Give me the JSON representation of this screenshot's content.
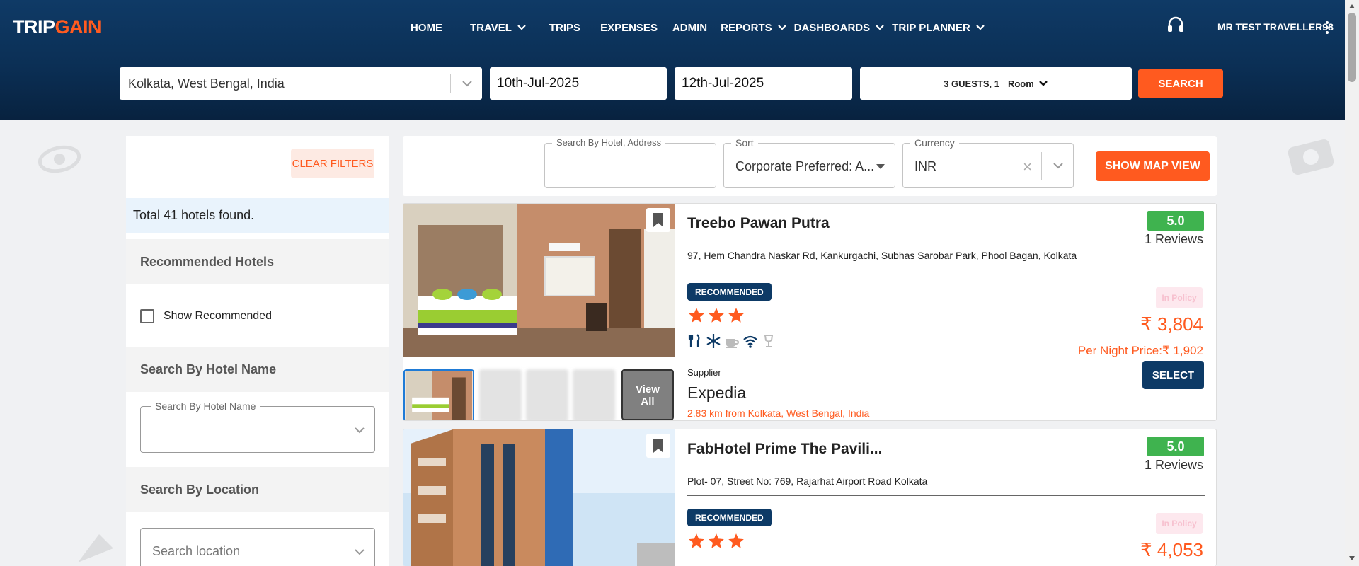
{
  "header": {
    "logo_left": "TRIP",
    "logo_right": "GAIN",
    "nav": [
      {
        "label": "HOME",
        "dropdown": false
      },
      {
        "label": "TRAVEL",
        "dropdown": true
      },
      {
        "label": "TRIPS",
        "dropdown": false
      },
      {
        "label": "EXPENSES",
        "dropdown": false
      },
      {
        "label": "ADMIN",
        "dropdown": false
      },
      {
        "label": "REPORTS",
        "dropdown": true
      },
      {
        "label": "DASHBOARDS",
        "dropdown": true
      },
      {
        "label": "TRIP PLANNER",
        "dropdown": true
      }
    ],
    "user": "MR TEST TRAVELLER98"
  },
  "search": {
    "location": "Kolkata, West Bengal, India",
    "checkin": "10th-Jul-2025",
    "checkout": "12th-Jul-2025",
    "guests": "3 GUESTS, 1",
    "room": "Room",
    "button": "SEARCH"
  },
  "sidebar": {
    "clear_filters": "CLEAR FILTERS",
    "total": "Total 41 hotels found.",
    "recommended_head": "Recommended Hotels",
    "show_recommended": "Show Recommended",
    "hotel_name_head": "Search By Hotel Name",
    "hotel_name_label": "Search By Hotel Name",
    "location_head": "Search By Location",
    "location_placeholder": "Search location"
  },
  "filters": {
    "search_label": "Search By Hotel, Address",
    "search_value": "",
    "sort_label": "Sort",
    "sort_value": "Corporate Preferred: A...",
    "currency_label": "Currency",
    "currency_value": "INR",
    "map_button": "SHOW MAP VIEW"
  },
  "hotels": [
    {
      "name": "Treebo Pawan Putra",
      "address": "97, Hem Chandra Naskar Rd, Kankurgachi, Subhas Sarobar Park, Phool Bagan, Kolkata",
      "score": "5.0",
      "reviews": "1 Reviews",
      "badge": "RECOMMENDED",
      "stars": 3,
      "policy": "In Policy",
      "price": "₹ 3,804",
      "per_night": "Per Night Price:₹ 1,902",
      "supplier_label": "Supplier",
      "supplier": "Expedia",
      "distance": "2.83 km from Kolkata, West Bengal, India",
      "select": "SELECT",
      "view_all": "View All"
    },
    {
      "name": "FabHotel Prime The Pavili...",
      "address": "Plot- 07, Street No: 769, Rajarhat Airport Road Kolkata",
      "score": "5.0",
      "reviews": "1 Reviews",
      "badge": "RECOMMENDED",
      "stars": 3,
      "policy": "In Policy",
      "price": "₹ 4,053"
    }
  ],
  "colors": {
    "brand_orange": "#ff5a1f",
    "navy": "#0d3a66",
    "score_green": "#3fb34f"
  }
}
